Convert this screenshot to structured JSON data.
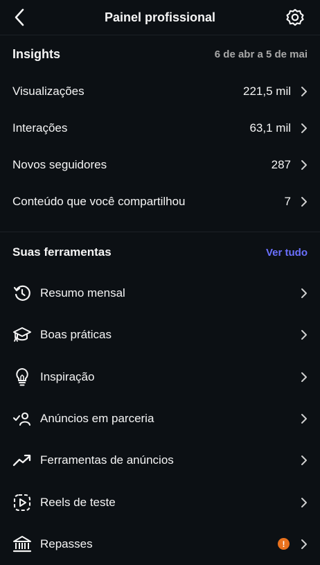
{
  "header": {
    "title": "Painel profissional",
    "back_icon": "back-arrow-icon",
    "settings_icon": "settings-gear-icon"
  },
  "insights": {
    "title": "Insights",
    "date_range": "6 de abr a 5 de mai",
    "rows": [
      {
        "label": "Visualizações",
        "value": "221,5 mil"
      },
      {
        "label": "Interações",
        "value": "63,1 mil"
      },
      {
        "label": "Novos seguidores",
        "value": "287"
      },
      {
        "label": "Conteúdo que você compartilhou",
        "value": "7"
      }
    ]
  },
  "tools": {
    "title": "Suas ferramentas",
    "see_all": "Ver tudo",
    "items": [
      {
        "label": "Resumo mensal",
        "icon": "history-clock-icon"
      },
      {
        "label": "Boas práticas",
        "icon": "graduation-cap-icon"
      },
      {
        "label": "Inspiração",
        "icon": "lightbulb-icon"
      },
      {
        "label": "Anúncios em parceria",
        "icon": "partner-check-person-icon"
      },
      {
        "label": "Ferramentas de anúncios",
        "icon": "trending-up-icon"
      },
      {
        "label": "Reels de teste",
        "icon": "reels-test-icon"
      },
      {
        "label": "Repasses",
        "icon": "bank-icon",
        "badge": "!"
      }
    ]
  },
  "colors": {
    "background": "#0c1014",
    "link": "#6b70ff",
    "badge": "#e8711d"
  }
}
